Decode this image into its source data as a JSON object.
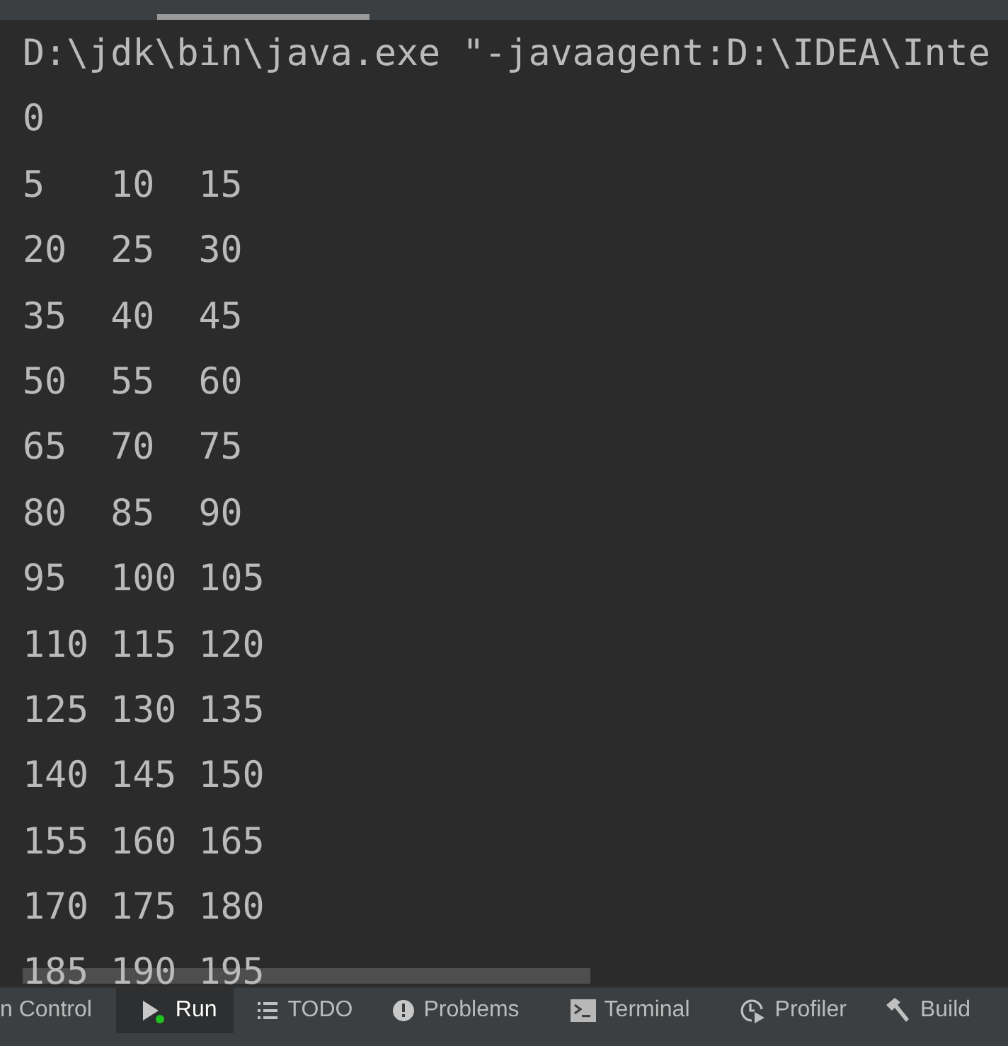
{
  "console": {
    "lines": [
      "D:\\jdk\\bin\\java.exe \"-javaagent:D:\\IDEA\\Inte",
      "0",
      "5   10  15",
      "20  25  30",
      "35  40  45",
      "50  55  60",
      "65  70  75",
      "80  85  90",
      "95  100 105",
      "110 115 120",
      "125 130 135",
      "140 145 150",
      "155 160 165",
      "170 175 180",
      "185 190 195"
    ]
  },
  "tool_windows": [
    {
      "label": "n Control",
      "kind": "plain",
      "selected": false
    },
    {
      "label": "Run",
      "kind": "run",
      "selected": true
    },
    {
      "label": "TODO",
      "kind": "list",
      "selected": false
    },
    {
      "label": "Problems",
      "kind": "problems",
      "selected": false
    },
    {
      "label": "Terminal",
      "kind": "terminal",
      "selected": false
    },
    {
      "label": "Profiler",
      "kind": "profiler",
      "selected": false
    },
    {
      "label": "Build",
      "kind": "build",
      "selected": false
    }
  ]
}
